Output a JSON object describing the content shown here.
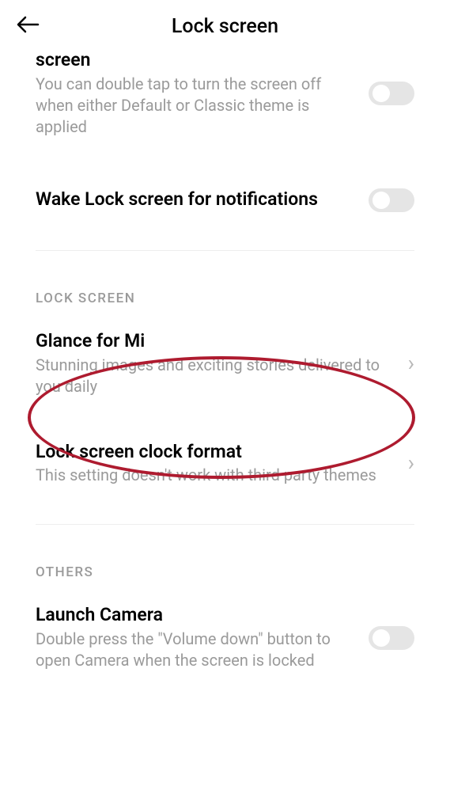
{
  "header": {
    "title": "Lock screen"
  },
  "settings": {
    "double_tap": {
      "title_fragment": "screen",
      "subtitle": "You can double tap to turn the screen off when either Default or Classic theme is applied"
    },
    "wake": {
      "title": "Wake Lock screen for notifications"
    }
  },
  "section_lock_screen": {
    "header": "LOCK SCREEN",
    "glance": {
      "title": "Glance for Mi",
      "subtitle": "Stunning images and exciting stories delivered to you daily"
    },
    "clock_format": {
      "title": "Lock screen clock format",
      "subtitle": "This setting doesn't work with third party themes"
    }
  },
  "section_others": {
    "header": "OTHERS",
    "launch_camera": {
      "title": "Launch Camera",
      "subtitle": "Double press the \"Volume down\" button to open Camera when the screen is locked"
    }
  }
}
